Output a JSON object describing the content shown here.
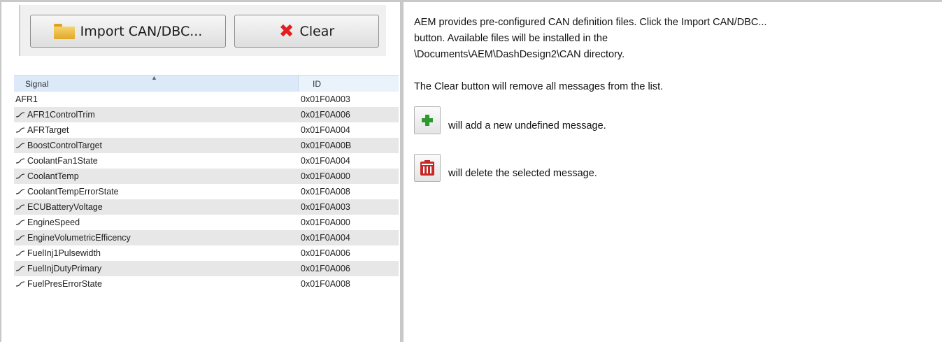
{
  "toolbar": {
    "import_label": "Import CAN/DBC...",
    "clear_label": "Clear"
  },
  "table": {
    "columns": [
      "Signal",
      "ID"
    ],
    "rows": [
      {
        "signal": "AFR1",
        "id": "0x01F0A003",
        "icon": false
      },
      {
        "signal": "AFR1ControlTrim",
        "id": "0x01F0A006",
        "icon": true
      },
      {
        "signal": "AFRTarget",
        "id": "0x01F0A004",
        "icon": true
      },
      {
        "signal": "BoostControlTarget",
        "id": "0x01F0A00B",
        "icon": true
      },
      {
        "signal": "CoolantFan1State",
        "id": "0x01F0A004",
        "icon": true
      },
      {
        "signal": "CoolantTemp",
        "id": "0x01F0A000",
        "icon": true
      },
      {
        "signal": "CoolantTempErrorState",
        "id": "0x01F0A008",
        "icon": true
      },
      {
        "signal": "ECUBatteryVoltage",
        "id": "0x01F0A003",
        "icon": true
      },
      {
        "signal": "EngineSpeed",
        "id": "0x01F0A000",
        "icon": true
      },
      {
        "signal": "EngineVolumetricEfficency",
        "id": "0x01F0A004",
        "icon": true
      },
      {
        "signal": "FuelInj1Pulsewidth",
        "id": "0x01F0A006",
        "icon": true
      },
      {
        "signal": "FuelInjDutyPrimary",
        "id": "0x01F0A006",
        "icon": true
      },
      {
        "signal": "FuelPresErrorState",
        "id": "0x01F0A008",
        "icon": true
      }
    ]
  },
  "description": {
    "p1_line1": "AEM provides pre-configured CAN definition files.  Click the Import CAN/DBC...",
    "p1_line2": "button.  Available files will be installed in the",
    "p1_line3": "\\Documents\\AEM\\DashDesign2\\CAN directory.",
    "p2": "The Clear button will remove all messages from the list.",
    "add_text": "will add a new undefined message.",
    "delete_text": "will delete the selected message."
  },
  "colors": {
    "add_icon": "#2e9a2e",
    "delete_icon": "#c62828",
    "clear_x": "#e02020",
    "folder": "#e8b43a"
  }
}
